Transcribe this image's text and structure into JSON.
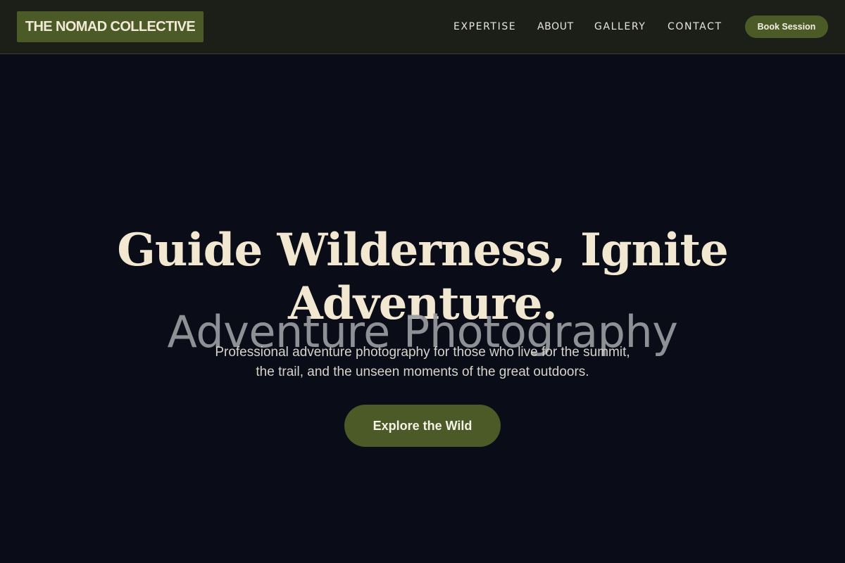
{
  "header": {
    "logo": "THE NOMAD COLLECTIVE",
    "nav": [
      "EXPERTISE",
      "ABOUT",
      "GALLERY",
      "CONTACT"
    ],
    "cta_label": "Book Session"
  },
  "hero": {
    "title_lines": [
      "Guide Wilderness, Ignite",
      "Adventure."
    ],
    "overlay_text": "Adventure Photography",
    "subtitle_lines": [
      "Professional adventure photography for those who live for the summit,",
      "the trail, and the unseen moments of the great outdoors."
    ],
    "cta_label": "Explore the Wild"
  },
  "colors": {
    "header_bg": "#1b1f17",
    "page_bg": "#0a0d18",
    "accent": "#4b5a26",
    "title_text": "#f2e8d2",
    "nav_text": "#e9e6dc"
  }
}
